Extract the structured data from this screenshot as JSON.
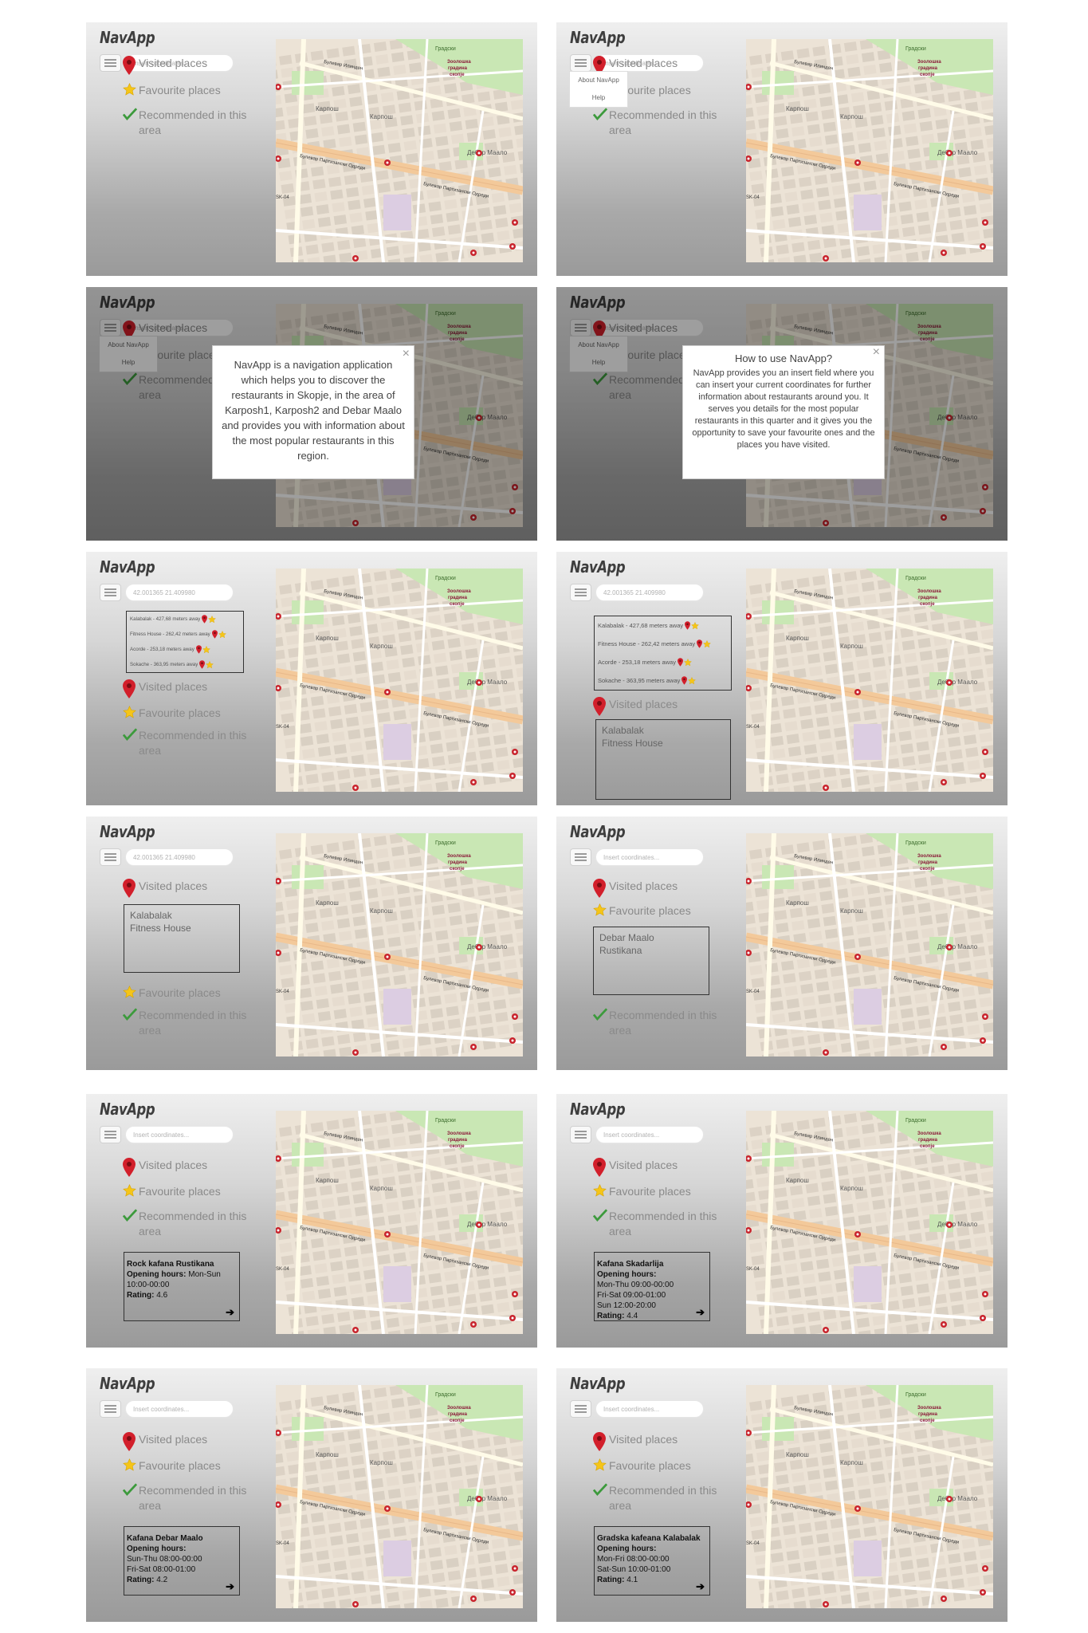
{
  "app": {
    "title": "NavApp",
    "placeholder": "Insert coordinates...",
    "coords_value": "42.001365 21.409980",
    "nav": {
      "visited": "Visited places",
      "favourite": "Favourite places",
      "recommended_1": "Recommended in this",
      "recommended_2": "area"
    },
    "menu": {
      "about": "About NavApp",
      "help": "Help"
    },
    "about_text": "NavApp is a navigation application which helps you to discover the restaurants in Skopje, in the area of Karposh1, Karposh2 and Debar Maalo and provides you with information about the most popular restaurants in this region.",
    "help_title": "How to use NavApp?",
    "help_text": "NavApp provides you an insert field where you can insert your current coordinates for further information about restaurants around you. It serves you details for the most popular restaurants in this quarter and it gives you the opportunity to save your favourite ones and the places you have visited.",
    "close_symbol": "×",
    "nearby": [
      "Kalabalak - 427,68 meters away",
      "Fitness House - 262,42 meters away",
      "Acorde - 253,18 meters away",
      "Sokache - 363,95 meters away"
    ],
    "visited_list": [
      "Kalabalak",
      "Fitness House"
    ],
    "favourite_list": [
      "Debar Maalo",
      "Rustikana"
    ],
    "restaurants": [
      {
        "name": "Rock kafana Rustikana",
        "hours_label": "Opening hours:",
        "hours": [
          "Mon-Sun 10:00-00:00"
        ],
        "rating_label": "Rating:",
        "rating": "4.6"
      },
      {
        "name": "Kafana Skadarlija",
        "hours_label": "Opening hours:",
        "hours": [
          "Mon-Thu 09:00-00:00",
          "Fri-Sat 09:00-01:00",
          "Sun 12:00-20:00"
        ],
        "rating_label": "Rating:",
        "rating": "4.4"
      },
      {
        "name": "Kafana Debar Maalo",
        "hours_label": "Opening hours:",
        "hours": [
          "Sun-Thu 08:00-00:00",
          "Fri-Sat 08:00-01:00"
        ],
        "rating_label": "Rating:",
        "rating": "4.2"
      },
      {
        "name": "Gradska kafeana Kalabalak",
        "hours_label": "Opening hours:",
        "hours": [
          "Mon-Fri 08:00-00:00",
          "Sat-Sun 10:00-01:00"
        ],
        "rating_label": "Rating:",
        "rating": "4.1"
      }
    ],
    "next_arrow": "➔",
    "map_labels": {
      "park": "Зоолошка градина скопје",
      "gradski": "Градски",
      "blvd1": "Булевар Илинден",
      "blvd2": "Булевар Партизански Одреди",
      "karposh": "Карпош",
      "debar": "Дебар Маало",
      "market": "Зелен пазар",
      "sk": "SK-04"
    },
    "colors": {
      "pin": "#d21f2b",
      "star": "#f5c518",
      "check": "#3c9a3c",
      "road": "#f3c99a",
      "park": "#c9e7b4"
    }
  }
}
